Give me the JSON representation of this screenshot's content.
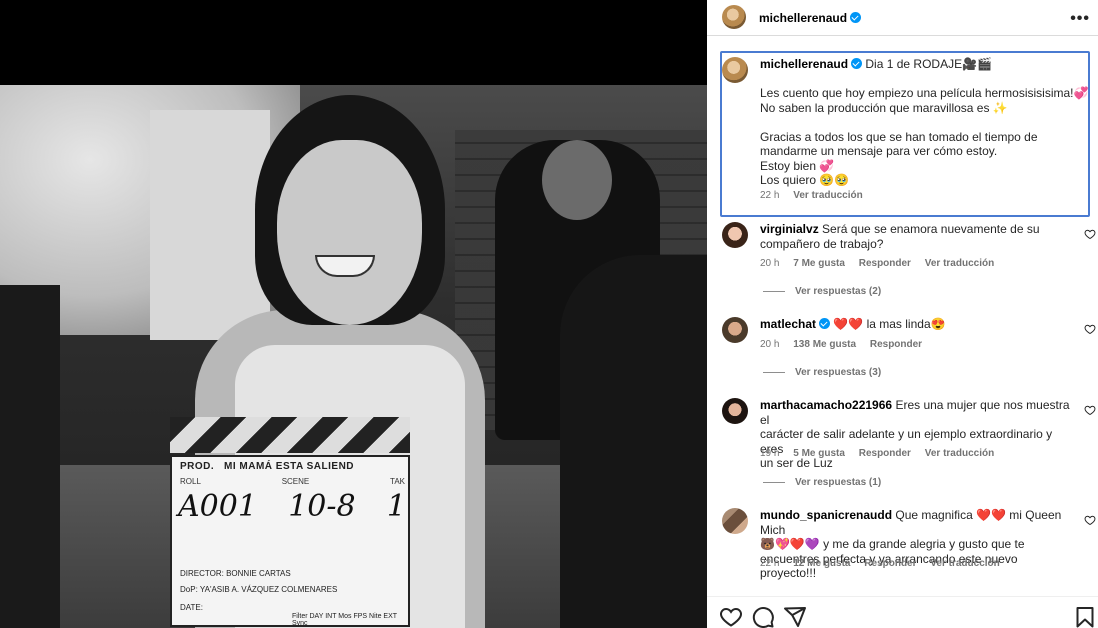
{
  "post": {
    "clapper": {
      "prod_label": "PROD.",
      "title": "MI MAMÁ ESTA SALIEND",
      "roll_label": "ROLL",
      "scene_label": "SCENE",
      "take_label": "TAK",
      "roll": "A001",
      "scene": "10-8",
      "take": "1",
      "director": "DIRECTOR: BONNIE CARTAS",
      "dop": "DoP: YA'ASIB A. VÁZQUEZ COLMENARES",
      "date": "DATE:",
      "extra": "Filter DAY INT Mos  FPS Nite EXT Sync"
    }
  },
  "header": {
    "username": "michellerenaud",
    "more_label": "•••"
  },
  "caption": {
    "username": "michellerenaud",
    "title": "Dia 1 de RODAJE🎥🎬",
    "line1": "Les cuento que hoy empiezo una película hermosisisisima!💞",
    "line2": "No saben la producción que maravillosa es ✨",
    "line3": "Gracias a todos los que se han tomado el tiempo de",
    "line4": "mandarme un mensaje para ver cómo estoy.",
    "line5": "Estoy bien 💞",
    "line6": "Los quiero 🥹🥹",
    "time": "22 h",
    "translate": "Ver traducción"
  },
  "comments": [
    {
      "username": "virginialvz",
      "text_line1": "Será que se enamora nuevamente de su",
      "text_line2": "compañero de trabajo?",
      "time": "20 h",
      "likes": "7 Me gusta",
      "reply": "Responder",
      "translate": "Ver traducción",
      "replies": "Ver respuestas (2)"
    },
    {
      "username": "matlechat",
      "text_line1": "❤️❤️ la mas linda😍",
      "time": "20 h",
      "likes": "138 Me gusta",
      "reply": "Responder",
      "replies": "Ver respuestas (3)"
    },
    {
      "username": "marthacamacho221966",
      "text_line1": "Eres una mujer que nos muestra el",
      "text_line2": "carácter de salir adelante y un ejemplo extraordinario y eres",
      "text_line3": "un ser de Luz",
      "time": "19 h",
      "likes": "5 Me gusta",
      "reply": "Responder",
      "translate": "Ver traducción",
      "replies": "Ver respuestas (1)"
    },
    {
      "username": "mundo_spanicrenaudd",
      "text_line1": "Que magnifica ❤️❤️ mi Queen Mich",
      "text_line2": "🐻💖❤️💜 y me da grande alegria y gusto que te",
      "text_line3": "encuentres perfecta y ya arrancando este nuevo proyecto!!!",
      "time": "22 h",
      "likes": "12 Me gusta",
      "reply": "Responder",
      "translate": "Ver traducción"
    }
  ],
  "colors": {
    "verified": "#0095f6",
    "focus_border": "#4a7bd1",
    "meta_text": "#737373"
  },
  "icons": [
    "heart-icon",
    "comment-icon",
    "share-icon",
    "bookmark-icon",
    "verified-badge-icon",
    "more-options-icon"
  ]
}
